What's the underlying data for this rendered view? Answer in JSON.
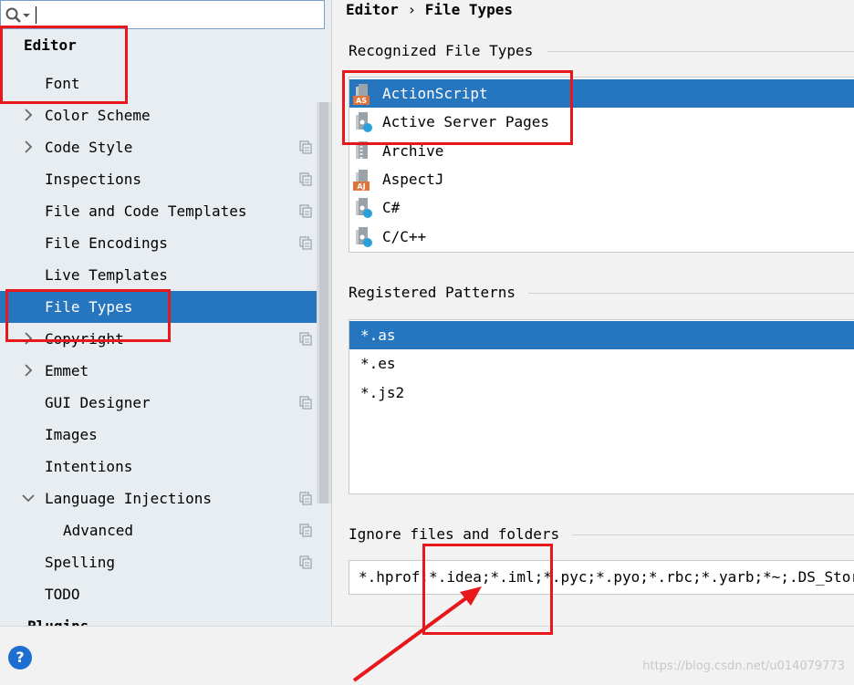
{
  "search": {
    "value": "",
    "icon": "search-icon"
  },
  "sidebar": {
    "items": [
      {
        "label": "Editor",
        "bold": true
      },
      {
        "label": "Font"
      },
      {
        "label": "Color Scheme",
        "expandable": true
      },
      {
        "label": "Code Style",
        "expandable": true,
        "copy": true
      },
      {
        "label": "Inspections",
        "copy": true
      },
      {
        "label": "File and Code Templates",
        "copy": true
      },
      {
        "label": "File Encodings",
        "copy": true
      },
      {
        "label": "Live Templates"
      },
      {
        "label": "File Types",
        "selected": true
      },
      {
        "label": "Copyright",
        "expandable": true,
        "copy": true
      },
      {
        "label": "Emmet",
        "expandable": true
      },
      {
        "label": "GUI Designer",
        "copy": true
      },
      {
        "label": "Images"
      },
      {
        "label": "Intentions"
      },
      {
        "label": "Language Injections",
        "expanded": true,
        "copy": true
      },
      {
        "label": "Advanced",
        "copy": true
      },
      {
        "label": "Spelling",
        "copy": true
      },
      {
        "label": "TODO"
      },
      {
        "label": "Plugins",
        "bold": true
      }
    ]
  },
  "breadcrumb": {
    "parent": "Editor",
    "sep": "›",
    "current": "File Types"
  },
  "recognized": {
    "title": "Recognized File Types",
    "items": [
      {
        "label": "ActionScript",
        "icon": "actionscript-file-icon",
        "badge": "AS",
        "selected": true
      },
      {
        "label": "Active Server Pages",
        "icon": "asp-file-icon"
      },
      {
        "label": "Archive",
        "icon": "archive-file-icon"
      },
      {
        "label": "AspectJ",
        "icon": "aspectj-file-icon",
        "badge": "AJ"
      },
      {
        "label": "C#",
        "icon": "csharp-file-icon"
      },
      {
        "label": "C/C++",
        "icon": "cpp-file-icon"
      }
    ]
  },
  "patterns": {
    "title": "Registered Patterns",
    "items": [
      {
        "label": "*.as",
        "selected": true
      },
      {
        "label": "*.es"
      },
      {
        "label": "*.js2"
      }
    ]
  },
  "ignore": {
    "title": "Ignore files and folders",
    "value": "*.hprof;*.idea;*.iml;*.pyc;*.pyo;*.rbc;*.yarb;*~;.DS_Store;"
  },
  "footer": {
    "help": "?",
    "watermark": "https://blog.csdn.net/u014079773"
  },
  "colors": {
    "selection": "#2675bf",
    "annotation": "#e8171c",
    "help": "#1c6ed1"
  }
}
